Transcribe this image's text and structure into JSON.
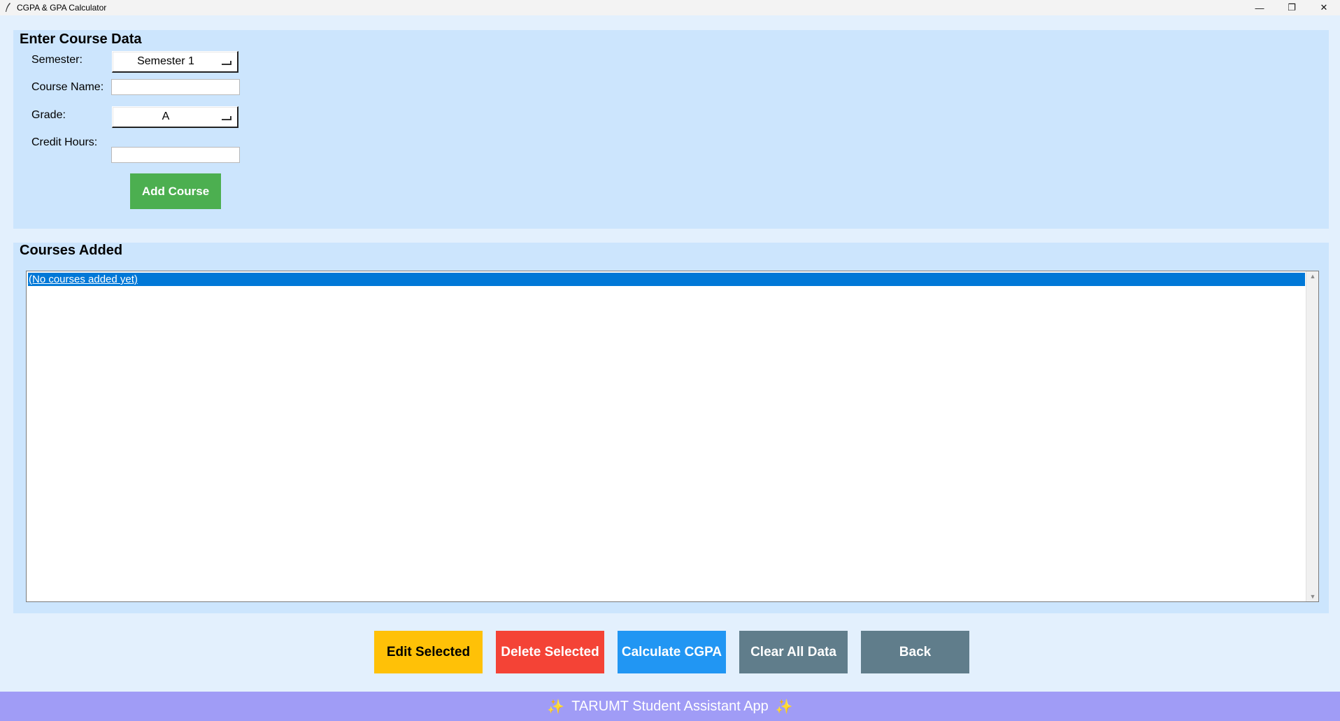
{
  "window": {
    "title": "CGPA & GPA Calculator",
    "minimize_glyph": "—",
    "restore_glyph": "❐",
    "close_glyph": "✕"
  },
  "entry_panel": {
    "title": "Enter Course Data",
    "semester_label": "Semester:",
    "semester_value": "Semester 1",
    "course_name_label": "Course Name:",
    "course_name_value": "",
    "grade_label": "Grade:",
    "grade_value": "A",
    "credit_hours_label": "Credit Hours:",
    "credit_hours_value": "",
    "add_button": "Add Course"
  },
  "courses_panel": {
    "title": "Courses Added",
    "items": [
      "(No courses added yet)"
    ],
    "scroll_up_glyph": "▲",
    "scroll_down_glyph": "▼"
  },
  "actions": {
    "edit": {
      "label": "Edit Selected",
      "bg": "#ffc107",
      "fg": "#000000"
    },
    "delete": {
      "label": "Delete Selected",
      "bg": "#f44336",
      "fg": "#ffffff"
    },
    "calculate": {
      "label": "Calculate CGPA",
      "bg": "#2196f3",
      "fg": "#ffffff"
    },
    "clear": {
      "label": "Clear All Data",
      "bg": "#607d8b",
      "fg": "#ffffff"
    },
    "back": {
      "label": "Back",
      "bg": "#607d8b",
      "fg": "#ffffff"
    }
  },
  "footer": {
    "text": "TARUMT Student Assistant App",
    "sparkle": "✨",
    "bg": "#a09cf6"
  },
  "colors": {
    "background": "#e3f0fd",
    "panel": "#cce5fd",
    "selection": "#0078d7",
    "add_button": "#4caf50"
  }
}
